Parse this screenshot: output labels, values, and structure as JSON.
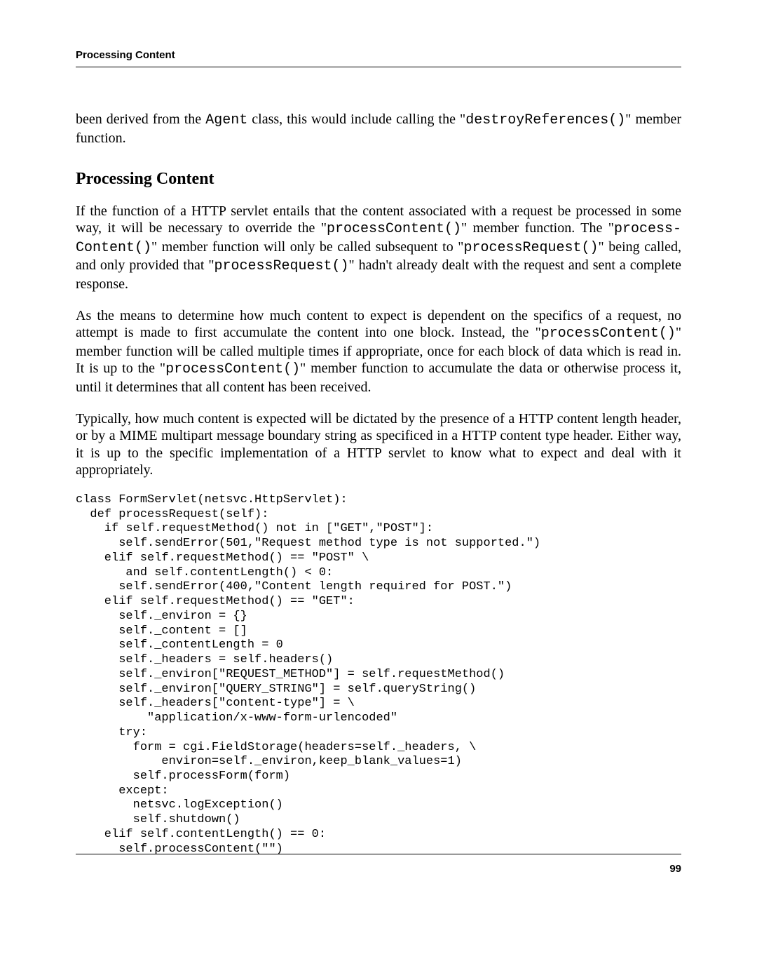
{
  "header": {
    "running_title": "Processing Content"
  },
  "intro": {
    "pre": "been derived from the ",
    "code1": "Agent",
    "mid": " class, this would include calling the \"",
    "code2": "destroyReferences()",
    "post": "\" member function."
  },
  "section_title": "Processing Content",
  "para1": {
    "a": "If the function of a HTTP servlet entails that the content associated with a request be processed in some way, it will be necessary to override the \"",
    "c1": "processContent()",
    "b": "\" member function. The \"",
    "c2": "process-Content()",
    "c": "\" member function will only be called subsequent to \"",
    "c3": "processRequest()",
    "d": "\" being called, and only provided that \"",
    "c4": "processRequest()",
    "e": "\" hadn't already dealt with the request and sent a complete response."
  },
  "para2": {
    "a": "As the means to determine how much content to expect is dependent on the specifics of a request, no attempt is made to first accumulate the content into one block. Instead, the \"",
    "c1": "processContent()",
    "b": "\" member function will be called multiple times if appropriate, once for each block of data which is read in. It is up to the \"",
    "c2": "processContent()",
    "c": "\" member function to accumulate the data or otherwise process it, until it determines that all content has been received."
  },
  "para3": "Typically, how much content is expected will be dictated by the presence of a HTTP content length header, or by a MIME multipart message boundary string as specificed in a HTTP content type header. Either way, it is up to the specific implementation of a HTTP servlet to know what to expect and deal with it appropriately.",
  "code": "class FormServlet(netsvc.HttpServlet):\n  def processRequest(self):\n    if self.requestMethod() not in [\"GET\",\"POST\"]:\n      self.sendError(501,\"Request method type is not supported.\")\n    elif self.requestMethod() == \"POST\" \\\n       and self.contentLength() < 0:\n      self.sendError(400,\"Content length required for POST.\")\n    elif self.requestMethod() == \"GET\":\n      self._environ = {}\n      self._content = []\n      self._contentLength = 0\n      self._headers = self.headers()\n      self._environ[\"REQUEST_METHOD\"] = self.requestMethod()\n      self._environ[\"QUERY_STRING\"] = self.queryString()\n      self._headers[\"content-type\"] = \\\n          \"application/x-www-form-urlencoded\"\n      try:\n        form = cgi.FieldStorage(headers=self._headers, \\\n            environ=self._environ,keep_blank_values=1)\n        self.processForm(form)\n      except:\n        netsvc.logException()\n        self.shutdown()\n    elif self.contentLength() == 0:\n      self.processContent(\"\")",
  "footer": {
    "page_number": "99"
  }
}
